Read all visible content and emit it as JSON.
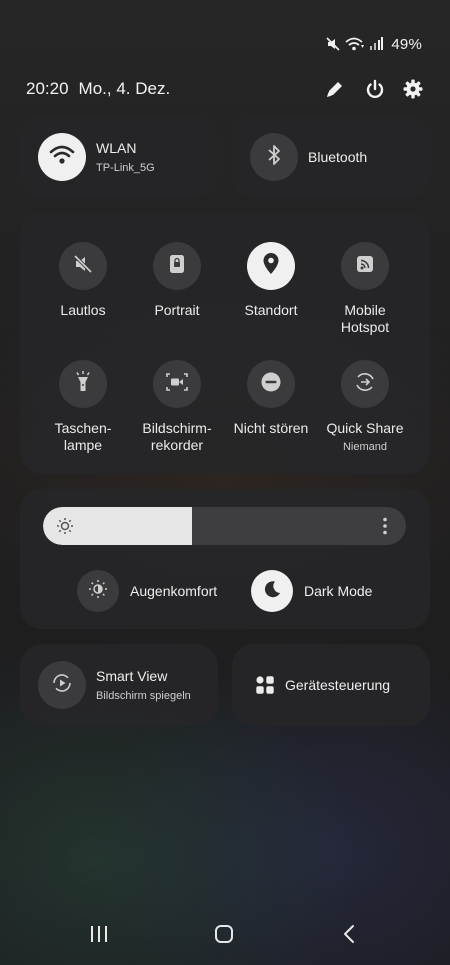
{
  "status_bar": {
    "battery": "49%",
    "icons": [
      "mute-icon",
      "wifi-icon",
      "signal-icon"
    ]
  },
  "header": {
    "time": "20:20",
    "date": "Mo., 4. Dez.",
    "icons": [
      "edit-icon",
      "power-icon",
      "settings-icon"
    ]
  },
  "wlan": {
    "title": "WLAN",
    "subtitle": "TP-Link_5G",
    "active": true
  },
  "bluetooth": {
    "title": "Bluetooth",
    "active": false
  },
  "tiles": [
    {
      "label": "Lautlos",
      "icon": "mute-icon",
      "active": false
    },
    {
      "label": "Portrait",
      "icon": "portrait-lock-icon",
      "active": false
    },
    {
      "label": "Standort",
      "icon": "location-icon",
      "active": true
    },
    {
      "label_lines": [
        "Mobile",
        "Hotspot"
      ],
      "icon": "hotspot-icon",
      "active": false
    },
    {
      "label_lines": [
        "Taschen-",
        "lampe"
      ],
      "icon": "flashlight-icon",
      "active": false
    },
    {
      "label_lines": [
        "Bildschirm-",
        "rekorder"
      ],
      "icon": "screen-recorder-icon",
      "active": false
    },
    {
      "label": "Nicht stören",
      "icon": "do-not-disturb-icon",
      "active": false
    },
    {
      "label": "Quick Share",
      "sublabel": "Niemand",
      "icon": "quick-share-icon",
      "active": false
    }
  ],
  "brightness": {
    "level": 0.41
  },
  "eye_comfort": {
    "label": "Augenkomfort",
    "active": false
  },
  "dark_mode": {
    "label": "Dark Mode",
    "active": true
  },
  "smart_view": {
    "title": "Smart View",
    "subtitle": "Bildschirm spiegeln"
  },
  "device_control": {
    "title": "Gerätesteuerung"
  },
  "nav": [
    "recent-apps-icon",
    "home-icon",
    "back-icon"
  ]
}
